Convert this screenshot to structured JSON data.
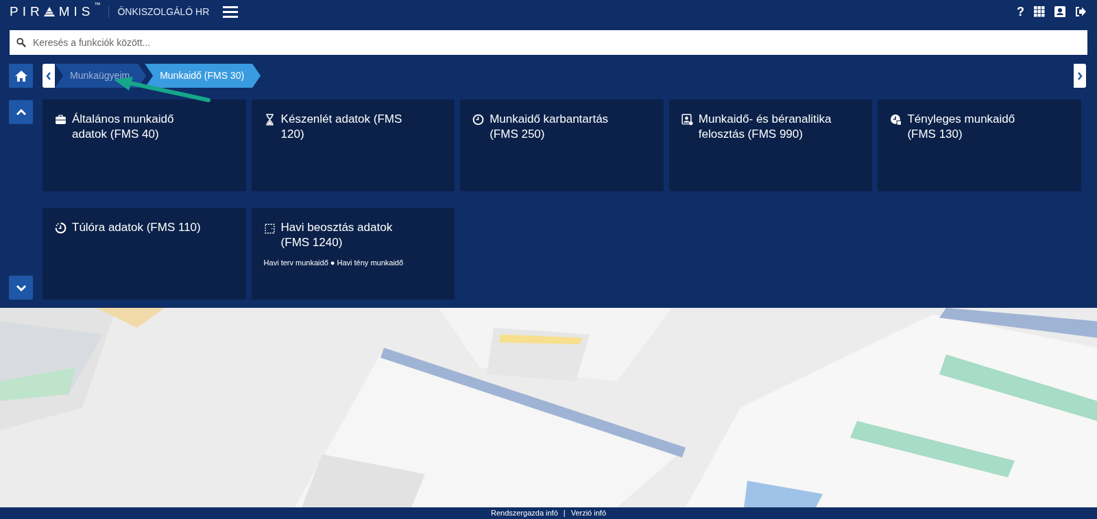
{
  "header": {
    "logo": {
      "before": "PIR",
      "after": "MIS",
      "mark": "™"
    },
    "app_title": "ÖNKISZOLGÁLÓ HR",
    "help": "?"
  },
  "search": {
    "placeholder": "Keresés a funkciók között..."
  },
  "breadcrumb": [
    {
      "label": "Munkaügyeim",
      "selected": false
    },
    {
      "label": "Munkaidő (FMS 30)",
      "selected": true
    }
  ],
  "tiles": [
    {
      "title": "Általános munkaidő adatok (FMS 40)"
    },
    {
      "title": "Készenlét adatok (FMS 120)"
    },
    {
      "title": "Munkaidő karbantartás (FMS 250)"
    },
    {
      "title": "Munkaidő- és béranalitika felosztás (FMS 990)"
    },
    {
      "title": "Tényleges munkaidő (FMS 130)"
    },
    {
      "title": "Túlóra adatok (FMS 110)"
    },
    {
      "title": "Havi beosztás adatok (FMS 1240)",
      "subtitle": "Havi terv munkaidő ● Havi tény munkaidő"
    }
  ],
  "footer": {
    "links": [
      "Rendszergazda infó",
      "Verzió infó"
    ],
    "separator": "|"
  }
}
